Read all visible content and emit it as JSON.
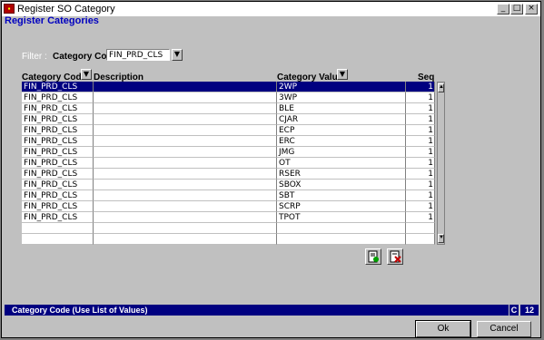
{
  "window": {
    "title": "Register SO Category",
    "minimize": "_",
    "maximize": "□",
    "close": "×"
  },
  "form_title": "Register Categories",
  "filter": {
    "label": "Filter :",
    "category_code_label": "Category Code",
    "category_code_value": "FIN_PRD_CLS"
  },
  "table": {
    "headers": {
      "category_code": "Category Code",
      "description": "Description",
      "category_value": "Category Value",
      "seq": "Seq"
    },
    "rows": [
      {
        "code": "FIN_PRD_CLS",
        "desc": "",
        "value": "2WP",
        "seq": "1"
      },
      {
        "code": "FIN_PRD_CLS",
        "desc": "",
        "value": "3WP",
        "seq": "1"
      },
      {
        "code": "FIN_PRD_CLS",
        "desc": "",
        "value": "BLE",
        "seq": "1"
      },
      {
        "code": "FIN_PRD_CLS",
        "desc": "",
        "value": "CJAR",
        "seq": "1"
      },
      {
        "code": "FIN_PRD_CLS",
        "desc": "",
        "value": "ECP",
        "seq": "1"
      },
      {
        "code": "FIN_PRD_CLS",
        "desc": "",
        "value": "ERC",
        "seq": "1"
      },
      {
        "code": "FIN_PRD_CLS",
        "desc": "",
        "value": "JMG",
        "seq": "1"
      },
      {
        "code": "FIN_PRD_CLS",
        "desc": "",
        "value": "OT",
        "seq": "1"
      },
      {
        "code": "FIN_PRD_CLS",
        "desc": "",
        "value": "RSER",
        "seq": "1"
      },
      {
        "code": "FIN_PRD_CLS",
        "desc": "",
        "value": "SBOX",
        "seq": "1"
      },
      {
        "code": "FIN_PRD_CLS",
        "desc": "",
        "value": "SBT",
        "seq": "1"
      },
      {
        "code": "FIN_PRD_CLS",
        "desc": "",
        "value": "SCRP",
        "seq": "1"
      },
      {
        "code": "FIN_PRD_CLS",
        "desc": "",
        "value": "TPOT",
        "seq": "1"
      },
      {
        "code": "",
        "desc": "",
        "value": "",
        "seq": ""
      },
      {
        "code": "",
        "desc": "",
        "value": "",
        "seq": ""
      }
    ],
    "selected_row": 0
  },
  "icons": {
    "add_record": "add-record-icon",
    "delete_record": "delete-record-icon"
  },
  "status": {
    "message": "Category Code (Use List of Values)",
    "mode": "C",
    "count": "12"
  },
  "buttons": {
    "ok": "Ok",
    "cancel": "Cancel"
  },
  "colors": {
    "selection": "#000080",
    "status_bar": "#000080",
    "form_title": "#0000c0"
  }
}
